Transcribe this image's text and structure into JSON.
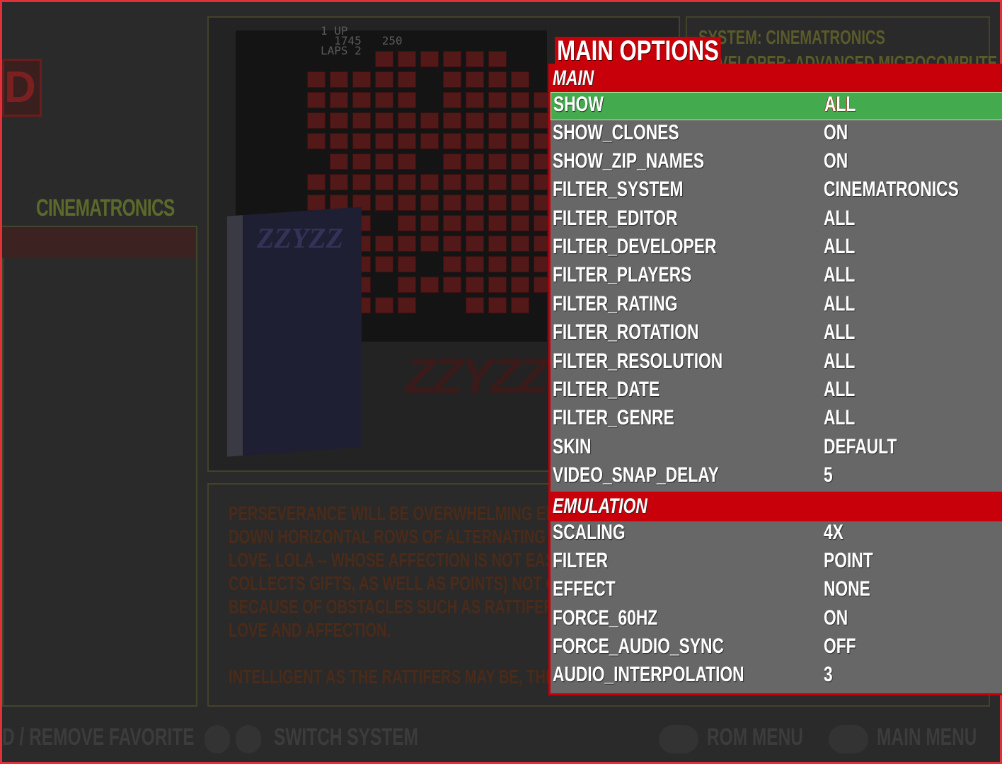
{
  "background": {
    "system_label": "CINEMATRONICS",
    "logo_fragment": "D",
    "system_header": "SYSTEM: CINEMATRONICS",
    "developer_fragment": "DEVELOPER: ADVANCED MICROCOMPUTE",
    "score": "1 UP\n  1745   250\nLAPS 2",
    "box_title": "ZZYZZ",
    "game_title": "ZZYZZ",
    "description_lines": [
      "PERSEVERANCE WILL BE OVERWHELMING EMO",
      "DOWN HORIZONTAL ROWS OF ALTERNATING M",
      "LOVE, LOLA -- WHOSE AFFECTION IS NOT EASIL",
      "COLLECTS GIFTS, AS WELL AS POINTS) NOT ON",
      "BECAUSE OF OBSTACLES SUCH AS RATTIFERS T",
      "LOVE AND AFFECTION.",
      "",
      "INTELLIGENT AS THE RATTIFERS MAY BE, THER"
    ],
    "footer": {
      "favorite": "D / REMOVE FAVORITE",
      "switch_system": "SWITCH SYSTEM",
      "rom_menu": "ROM MENU",
      "main_menu": "MAIN MENU"
    }
  },
  "menu": {
    "title": "MAIN OPTIONS",
    "sections": [
      {
        "name": "MAIN",
        "items": [
          {
            "label": "SHOW",
            "value": "ALL",
            "selected": true
          },
          {
            "label": "SHOW_CLONES",
            "value": "ON"
          },
          {
            "label": "SHOW_ZIP_NAMES",
            "value": "ON"
          },
          {
            "label": "FILTER_SYSTEM",
            "value": "CINEMATRONICS"
          },
          {
            "label": "FILTER_EDITOR",
            "value": "ALL"
          },
          {
            "label": "FILTER_DEVELOPER",
            "value": "ALL"
          },
          {
            "label": "FILTER_PLAYERS",
            "value": "ALL"
          },
          {
            "label": "FILTER_RATING",
            "value": "ALL"
          },
          {
            "label": "FILTER_ROTATION",
            "value": "ALL"
          },
          {
            "label": "FILTER_RESOLUTION",
            "value": "ALL"
          },
          {
            "label": "FILTER_DATE",
            "value": "ALL"
          },
          {
            "label": "FILTER_GENRE",
            "value": "ALL"
          },
          {
            "label": "SKIN",
            "value": "DEFAULT"
          },
          {
            "label": "VIDEO_SNAP_DELAY",
            "value": "5"
          }
        ]
      },
      {
        "name": "EMULATION",
        "items": [
          {
            "label": "SCALING",
            "value": "4X"
          },
          {
            "label": "FILTER",
            "value": "POINT"
          },
          {
            "label": "EFFECT",
            "value": "NONE"
          },
          {
            "label": "FORCE_60HZ",
            "value": "ON"
          },
          {
            "label": "FORCE_AUDIO_SYNC",
            "value": "OFF"
          },
          {
            "label": "AUDIO_INTERPOLATION",
            "value": "3"
          }
        ]
      }
    ]
  },
  "colors": {
    "section_header": "#c8000a",
    "selected_row": "#43ab4e",
    "menu_background": "#676767",
    "text": "#ffffff"
  }
}
